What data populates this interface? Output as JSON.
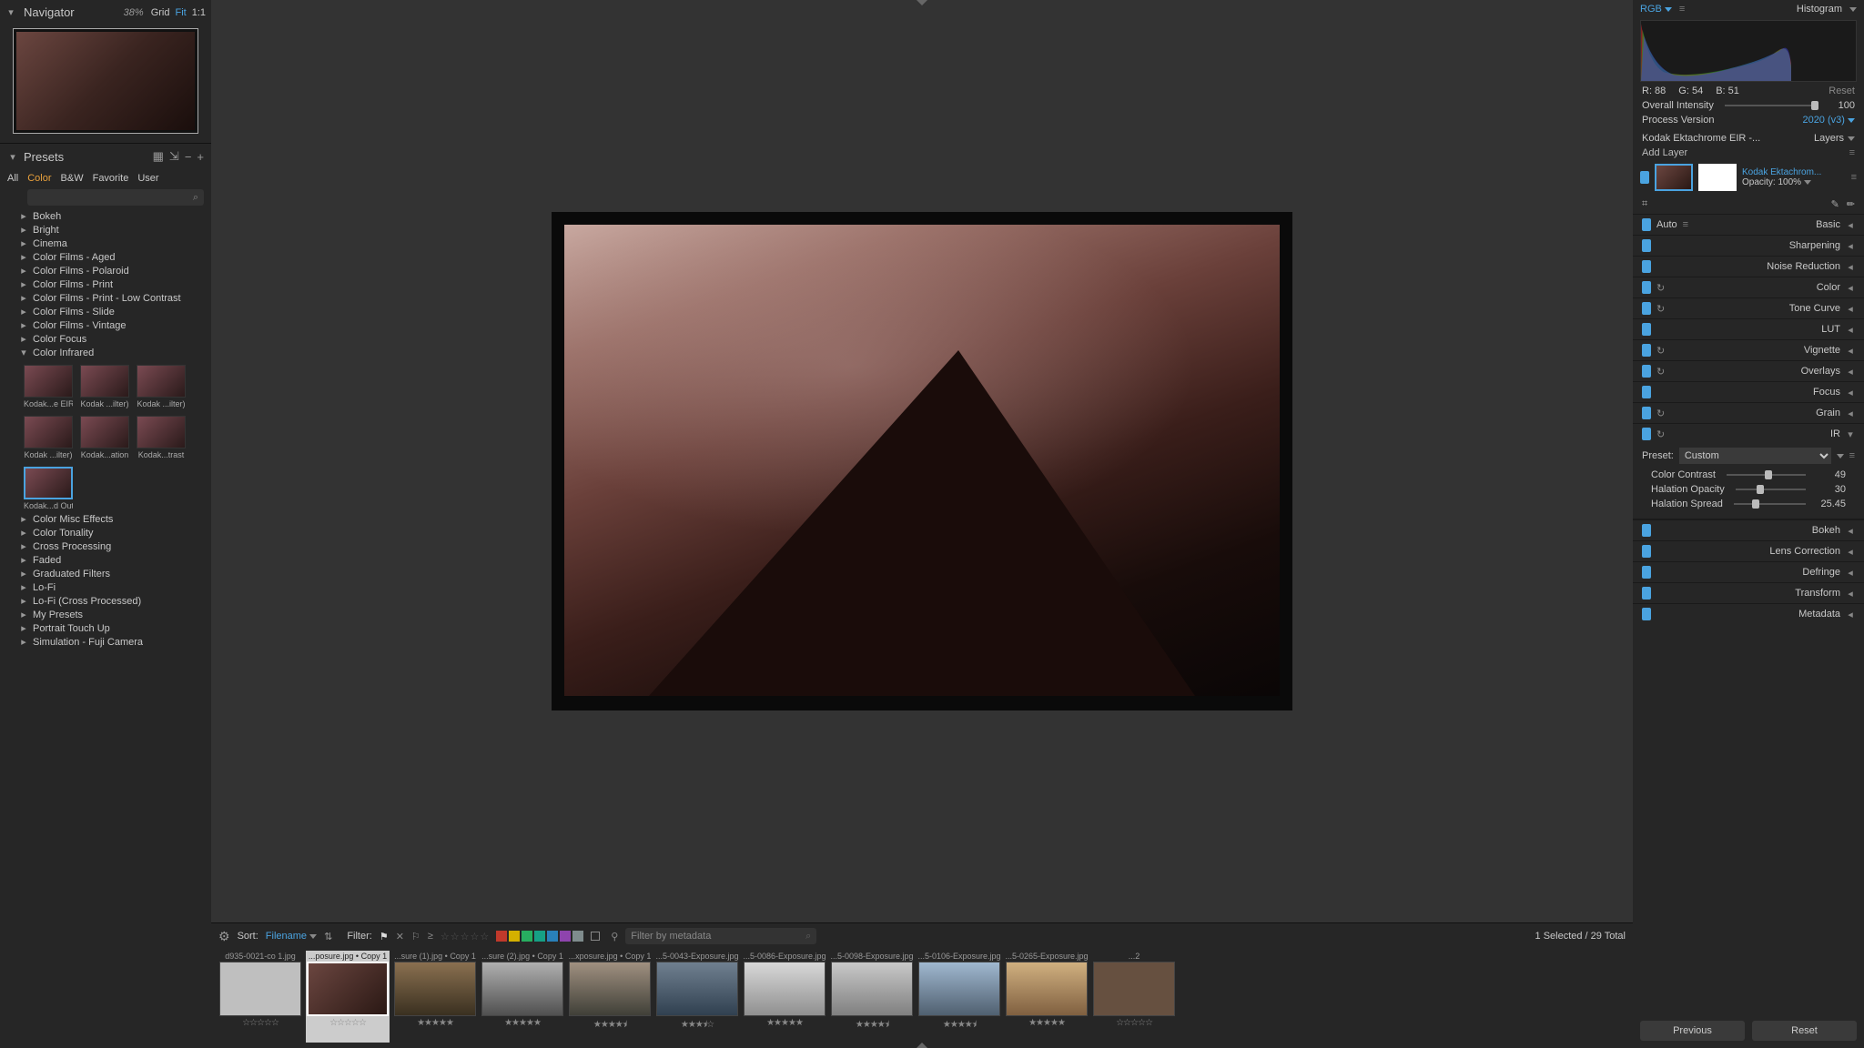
{
  "navigator": {
    "title": "Navigator",
    "zoom_pct": "38%",
    "grid": "Grid",
    "fit": "Fit",
    "one": "1:1"
  },
  "presets": {
    "title": "Presets",
    "tabs": {
      "all": "All",
      "color": "Color",
      "bw": "B&W",
      "favorite": "Favorite",
      "user": "User"
    },
    "search_placeholder": "",
    "groups": [
      "Bokeh",
      "Bright",
      "Cinema",
      "Color Films - Aged",
      "Color Films - Polaroid",
      "Color Films - Print",
      "Color Films - Print - Low Contrast",
      "Color Films - Slide",
      "Color Films - Vintage",
      "Color Focus"
    ],
    "open_group": "Color Infrared",
    "thumbs": [
      {
        "label": "Kodak...e EIR"
      },
      {
        "label": "Kodak ...ilter)"
      },
      {
        "label": "Kodak ...ilter)"
      },
      {
        "label": "Kodak ...ilter)"
      },
      {
        "label": "Kodak...ation"
      },
      {
        "label": "Kodak...trast"
      },
      {
        "label": "Kodak...d Out",
        "selected": true
      }
    ],
    "groups_after": [
      "Color Misc Effects",
      "Color Tonality",
      "Cross Processing",
      "Faded",
      "Graduated Filters",
      "Lo-Fi",
      "Lo-Fi (Cross Processed)",
      "My Presets",
      "Portrait Touch Up",
      "Simulation - Fuji Camera"
    ]
  },
  "filmstrip": {
    "sort_label": "Sort:",
    "sort_value": "Filename",
    "filter_label": "Filter:",
    "meta_placeholder": "Filter by metadata",
    "count": "1 Selected / 29 Total",
    "swatches": [
      "#c0392b",
      "#d4b000",
      "#27ae60",
      "#16a085",
      "#2980b9",
      "#8e44ad",
      "#7f8c8d"
    ],
    "items": [
      {
        "name": "d935-0021-co 1.jpg",
        "stars": 0,
        "sel": false,
        "bg": "#bfbfbf"
      },
      {
        "name": "...posure.jpg • Copy 1",
        "stars": 0,
        "sel": true,
        "bg": "linear-gradient(135deg,#6b4640,#2a1814)"
      },
      {
        "name": "...sure (1).jpg • Copy 1",
        "stars": 5,
        "bg": "linear-gradient(#8a7050,#3a3020)"
      },
      {
        "name": "...sure (2).jpg • Copy 1",
        "stars": 5,
        "bg": "linear-gradient(#b0b0b0,#505050)"
      },
      {
        "name": "...xposure.jpg • Copy 1",
        "stars": 4.5,
        "bg": "linear-gradient(#a09080,#404038)"
      },
      {
        "name": "...5-0043-Exposure.jpg",
        "stars": 3.5,
        "bg": "linear-gradient(#708090,#304050)"
      },
      {
        "name": "...5-0086-Exposure.jpg",
        "stars": 5,
        "bg": "linear-gradient(#d8d8d8,#909090)"
      },
      {
        "name": "...5-0098-Exposure.jpg",
        "stars": 4.5,
        "bg": "linear-gradient(#c8c8c8,#808080)"
      },
      {
        "name": "...5-0106-Exposure.jpg",
        "stars": 4.5,
        "bg": "linear-gradient(#a0b8d0,#506070)"
      },
      {
        "name": "...5-0265-Exposure.jpg",
        "stars": 5,
        "bg": "linear-gradient(#d0b080,#806040)"
      },
      {
        "name": "...2",
        "stars": 0,
        "bg": "#665040"
      }
    ]
  },
  "right": {
    "channel": "RGB",
    "histogram_label": "Histogram",
    "r": "R: 88",
    "g": "G: 54",
    "b": "B: 51",
    "reset": "Reset",
    "overall_intensity": {
      "label": "Overall Intensity",
      "value": "100",
      "pos": 96
    },
    "process_version": {
      "label": "Process Version",
      "value": "2020 (v3)"
    },
    "layer_src": "Kodak Ektachrome EIR -...",
    "layers_label": "Layers",
    "add_layer": "Add Layer",
    "layer_name": "Kodak Ektachrom...",
    "opacity_label": "Opacity:",
    "opacity_value": "100%",
    "auto": "Auto",
    "sections": [
      {
        "name": "Basic",
        "reset": false,
        "open": false
      },
      {
        "name": "Sharpening",
        "reset": false,
        "open": false
      },
      {
        "name": "Noise Reduction",
        "reset": false,
        "open": false
      },
      {
        "name": "Color",
        "reset": true,
        "open": false
      },
      {
        "name": "Tone Curve",
        "reset": true,
        "open": false
      },
      {
        "name": "LUT",
        "reset": false,
        "open": false
      },
      {
        "name": "Vignette",
        "reset": true,
        "open": false
      },
      {
        "name": "Overlays",
        "reset": true,
        "open": false
      },
      {
        "name": "Focus",
        "reset": false,
        "open": false
      },
      {
        "name": "Grain",
        "reset": true,
        "open": false
      },
      {
        "name": "IR",
        "reset": true,
        "open": true
      }
    ],
    "ir": {
      "preset_label": "Preset:",
      "preset_value": "Custom",
      "color_contrast": {
        "label": "Color Contrast",
        "value": "49",
        "pos": 48
      },
      "halation_opacity": {
        "label": "Halation Opacity",
        "value": "30",
        "pos": 30
      },
      "halation_spread": {
        "label": "Halation Spread",
        "value": "25.45",
        "pos": 25
      }
    },
    "sections_after": [
      {
        "name": "Bokeh",
        "reset": false
      },
      {
        "name": "Lens Correction",
        "reset": false
      },
      {
        "name": "Defringe",
        "reset": false
      },
      {
        "name": "Transform",
        "reset": false
      },
      {
        "name": "Metadata",
        "reset": false
      }
    ],
    "previous": "Previous",
    "reset_btn": "Reset"
  }
}
